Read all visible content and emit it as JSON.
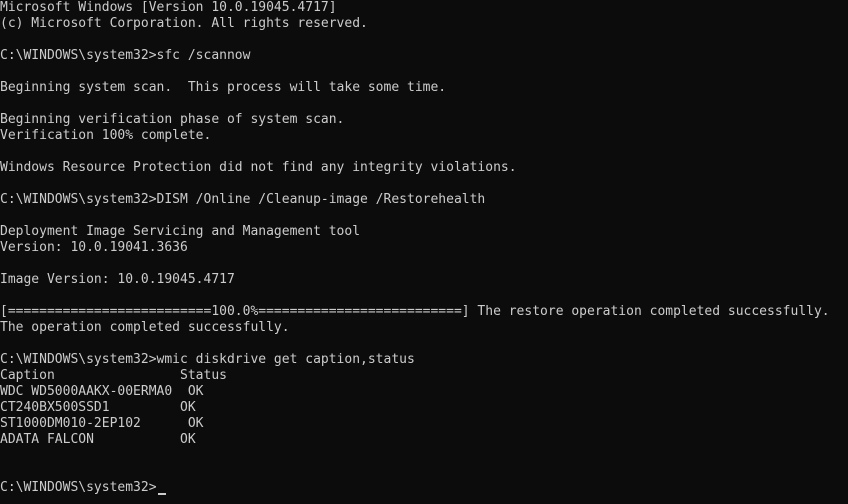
{
  "console": {
    "lines": [
      "Microsoft Windows [Version 10.0.19045.4717]",
      "(c) Microsoft Corporation. All rights reserved.",
      "",
      "C:\\WINDOWS\\system32>sfc /scannow",
      "",
      "Beginning system scan.  This process will take some time.",
      "",
      "Beginning verification phase of system scan.",
      "Verification 100% complete.",
      "",
      "Windows Resource Protection did not find any integrity violations.",
      "",
      "C:\\WINDOWS\\system32>DISM /Online /Cleanup-image /Restorehealth",
      "",
      "Deployment Image Servicing and Management tool",
      "Version: 10.0.19041.3636",
      "",
      "Image Version: 10.0.19045.4717",
      "",
      "[==========================100.0%==========================] The restore operation completed successfully.",
      "The operation completed successfully.",
      "",
      "C:\\WINDOWS\\system32>wmic diskdrive get caption,status",
      "Caption                Status",
      "WDC WD5000AAKX-00ERMA0  OK",
      "CT240BX500SSD1         OK",
      "ST1000DM010-2EP102      OK",
      "ADATA FALCON           OK",
      "",
      "",
      "C:\\WINDOWS\\system32>"
    ]
  }
}
